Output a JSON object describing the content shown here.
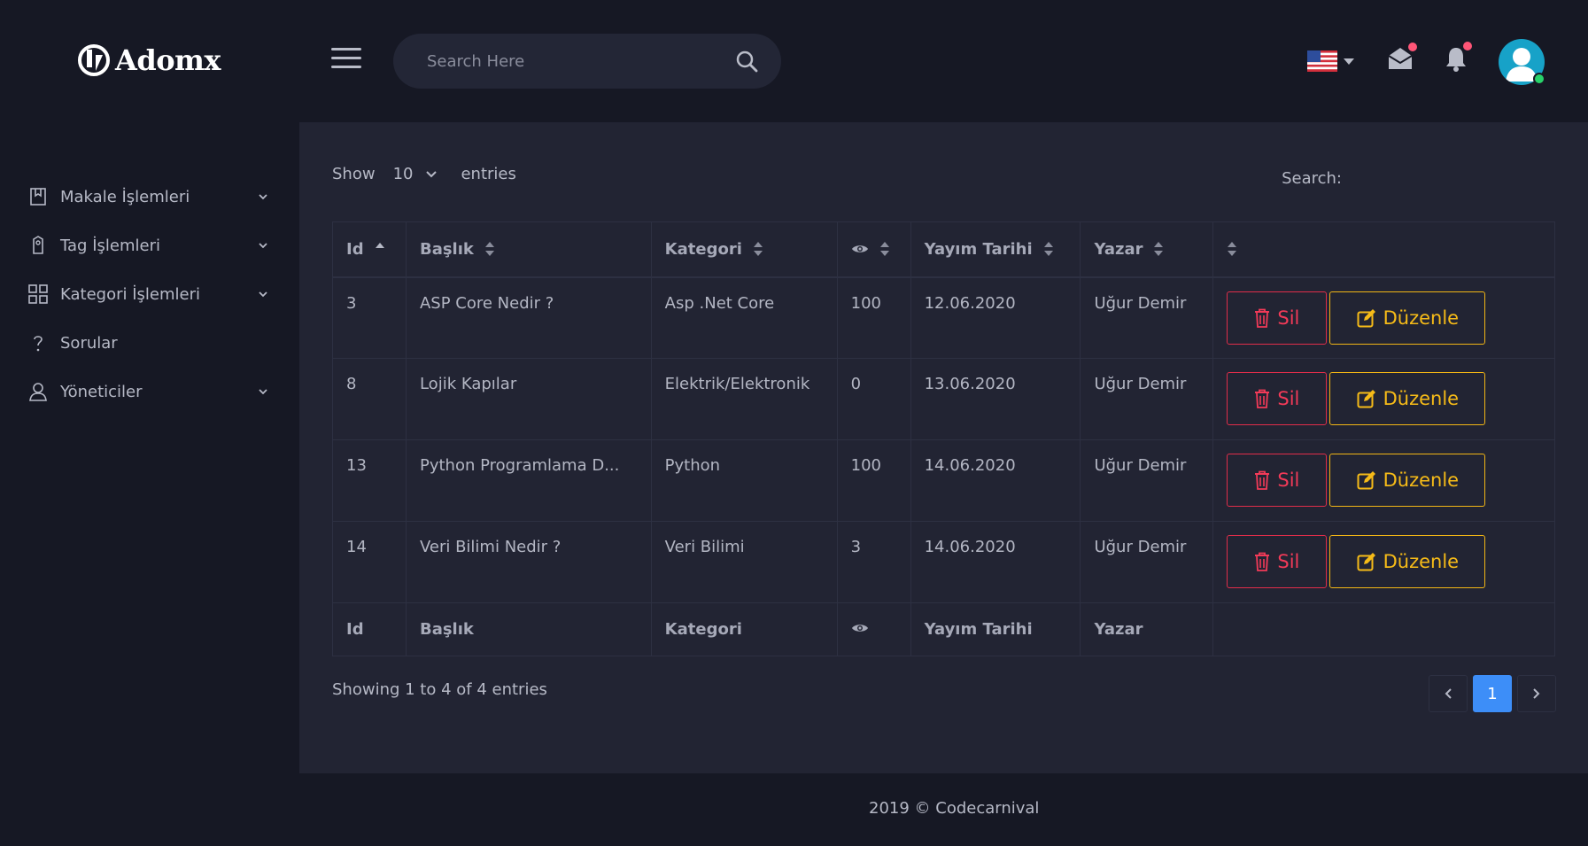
{
  "brand": {
    "name": "Adomx"
  },
  "header": {
    "search_placeholder": "Search Here",
    "language": "en-US",
    "mail_unread": true,
    "notifications_unread": true,
    "user_online": true
  },
  "sidebar": {
    "items": [
      {
        "label": "Makale İşlemleri",
        "icon": "book-icon",
        "has_children": true
      },
      {
        "label": "Tag İşlemleri",
        "icon": "tag-icon",
        "has_children": true
      },
      {
        "label": "Kategori İşlemleri",
        "icon": "grid-icon",
        "has_children": true
      },
      {
        "label": "Sorular",
        "icon": "question-icon",
        "has_children": false
      },
      {
        "label": "Yöneticiler",
        "icon": "user-icon",
        "has_children": true
      }
    ]
  },
  "table": {
    "show_label": "Show",
    "entries_value": "10",
    "entries_label": "entries",
    "search_label": "Search:",
    "columns": [
      "Id",
      "Başlık",
      "Kategori",
      "eye-icon",
      "Yayım Tarihi",
      "Yazar",
      ""
    ],
    "rows": [
      {
        "id": "3",
        "title": "ASP Core Nedir ?",
        "category": "Asp .Net Core",
        "views": "100",
        "date": "12.06.2020",
        "author": "Uğur Demir"
      },
      {
        "id": "8",
        "title": "Lojik Kapılar",
        "category": "Elektrik/Elektronik",
        "views": "0",
        "date": "13.06.2020",
        "author": "Uğur Demir"
      },
      {
        "id": "13",
        "title": "Python Programlama D...",
        "category": "Python",
        "views": "100",
        "date": "14.06.2020",
        "author": "Uğur Demir"
      },
      {
        "id": "14",
        "title": "Veri Bilimi Nedir ?",
        "category": "Veri Bilimi",
        "views": "3",
        "date": "14.06.2020",
        "author": "Uğur Demir"
      }
    ],
    "delete_label": "Sil",
    "edit_label": "Düzenle",
    "info": "Showing 1 to 4 of 4 entries",
    "current_page": "1"
  },
  "footer": {
    "text": "2019 © Codecarnival"
  },
  "colors": {
    "accent": "#3d8ef8",
    "danger": "#e02d4a",
    "warning": "#f1b515",
    "background": "#161824",
    "panel": "#222433"
  }
}
